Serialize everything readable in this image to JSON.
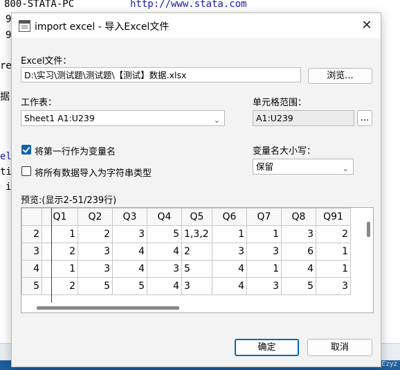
{
  "background": {
    "line1_left": "800-STATA-PC",
    "line1_right": "http://www.stata.com",
    "line2": "9",
    "line3": "9",
    "line4": "re",
    "line5": "据",
    "line6": "el",
    "line7": "ti",
    "line8": "i",
    "watermark": "CSDN @JADEzyz"
  },
  "dialog": {
    "title": "import excel - 导入Excel文件",
    "close_glyph": "✕",
    "excel_file_label": "Excel文件：",
    "excel_file_value": "D:\\实习\\测试题\\测试题\\【测试】数据.xlsx",
    "browse_label": "浏览...",
    "worksheet_label": "工作表：",
    "worksheet_value": "Sheet1 A1:U239",
    "cell_range_label": "单元格范围：",
    "cell_range_value": "A1:U239",
    "cell_range_btn": "...",
    "first_row_label": "将第一行作为变量名",
    "first_row_checked": true,
    "all_string_label": "将所有数据导入为字符串类型",
    "all_string_checked": false,
    "var_case_label": "变量名大小写：",
    "var_case_value": "保留",
    "preview_label": "预览:(显示2-51/239行)",
    "ok_label": "确定",
    "cancel_label": "取消"
  },
  "preview": {
    "columns": [
      "",
      "Q1",
      "Q2",
      "Q3",
      "Q4",
      "Q5",
      "Q6",
      "Q7",
      "Q8",
      "Q91"
    ],
    "rows": [
      [
        "2",
        "1",
        "2",
        "3",
        "5",
        "1,3,2",
        "1",
        "1",
        "3",
        "2"
      ],
      [
        "3",
        "2",
        "3",
        "4",
        "4",
        "2",
        "3",
        "3",
        "6",
        "1"
      ],
      [
        "4",
        "1",
        "3",
        "4",
        "3",
        "5",
        "4",
        "1",
        "4",
        "1"
      ],
      [
        "5",
        "2",
        "5",
        "5",
        "4",
        "3",
        "4",
        "3",
        "5",
        "3"
      ]
    ]
  },
  "colors": {
    "accent": "#0067c0",
    "checkbox": "#1060b0",
    "separator": "#2b2bd8"
  }
}
